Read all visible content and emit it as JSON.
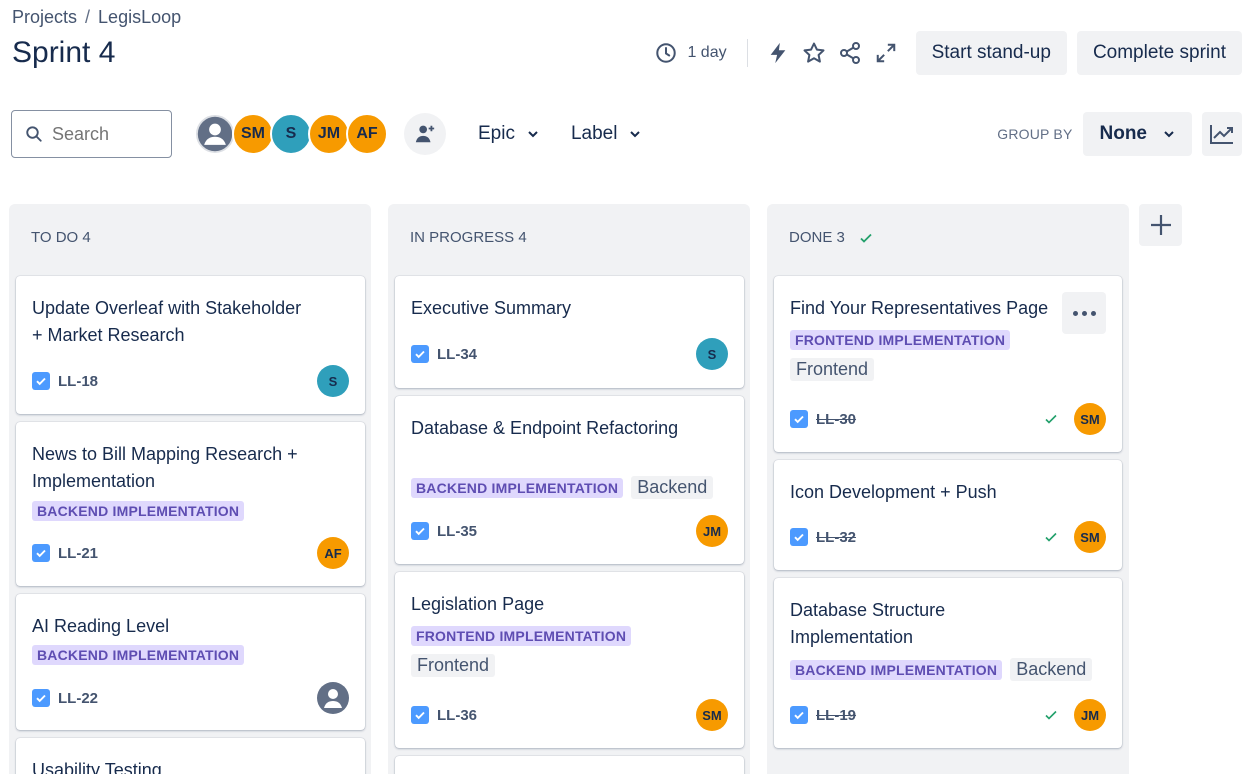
{
  "breadcrumb": {
    "root": "Projects",
    "separator": "/",
    "project": "LegisLoop"
  },
  "title": "Sprint 4",
  "header": {
    "time_left": "1 day",
    "start_standup": "Start stand-up",
    "complete_sprint": "Complete sprint"
  },
  "toolbar": {
    "search_placeholder": "Search",
    "avatars": [
      "SM",
      "S",
      "JM",
      "AF"
    ],
    "epic": "Epic",
    "label": "Label",
    "group_by": "GROUP BY",
    "group_value": "None"
  },
  "columns": [
    {
      "title": "TO DO 4"
    },
    {
      "title": "IN PROGRESS 4"
    },
    {
      "title": "DONE 3"
    }
  ],
  "todo": [
    {
      "title": "Update Overleaf with Stakeholder + Market Research",
      "key": "LL-18",
      "assignee": "S"
    },
    {
      "title": "News to Bill Mapping Research + Implementation",
      "epic": "BACKEND IMPLEMENTATION",
      "key": "LL-21",
      "assignee": "AF"
    },
    {
      "title": "AI Reading Level",
      "epic": "BACKEND IMPLEMENTATION",
      "key": "LL-22"
    },
    {
      "title": "Usability Testing"
    }
  ],
  "inprogress": [
    {
      "title": "Executive Summary",
      "key": "LL-34",
      "assignee": "S"
    },
    {
      "title": "Database & Endpoint Refactoring",
      "epic": "BACKEND IMPLEMENTATION",
      "label": "Backend",
      "key": "LL-35",
      "assignee": "JM"
    },
    {
      "title": "Legislation Page",
      "epic": "FRONTEND IMPLEMENTATION",
      "label": "Frontend",
      "key": "LL-36",
      "assignee": "SM"
    }
  ],
  "done": [
    {
      "title": "Find Your Representatives Page",
      "epic": "FRONTEND IMPLEMENTATION",
      "label": "Frontend",
      "key": "LL-30",
      "assignee": "SM"
    },
    {
      "title": "Icon Development + Push",
      "key": "LL-32",
      "assignee": "SM"
    },
    {
      "title": "Database Structure Implementation",
      "epic": "BACKEND IMPLEMENTATION",
      "label": "Backend",
      "key": "LL-19",
      "assignee": "JM"
    }
  ],
  "colors": {
    "orange": "#f79a00",
    "teal": "#2f9fbb",
    "epic_bg": "#dfd8fd",
    "epic_text": "#5e4db2",
    "check": "#4c9aff",
    "done_green": "#22a06b"
  }
}
